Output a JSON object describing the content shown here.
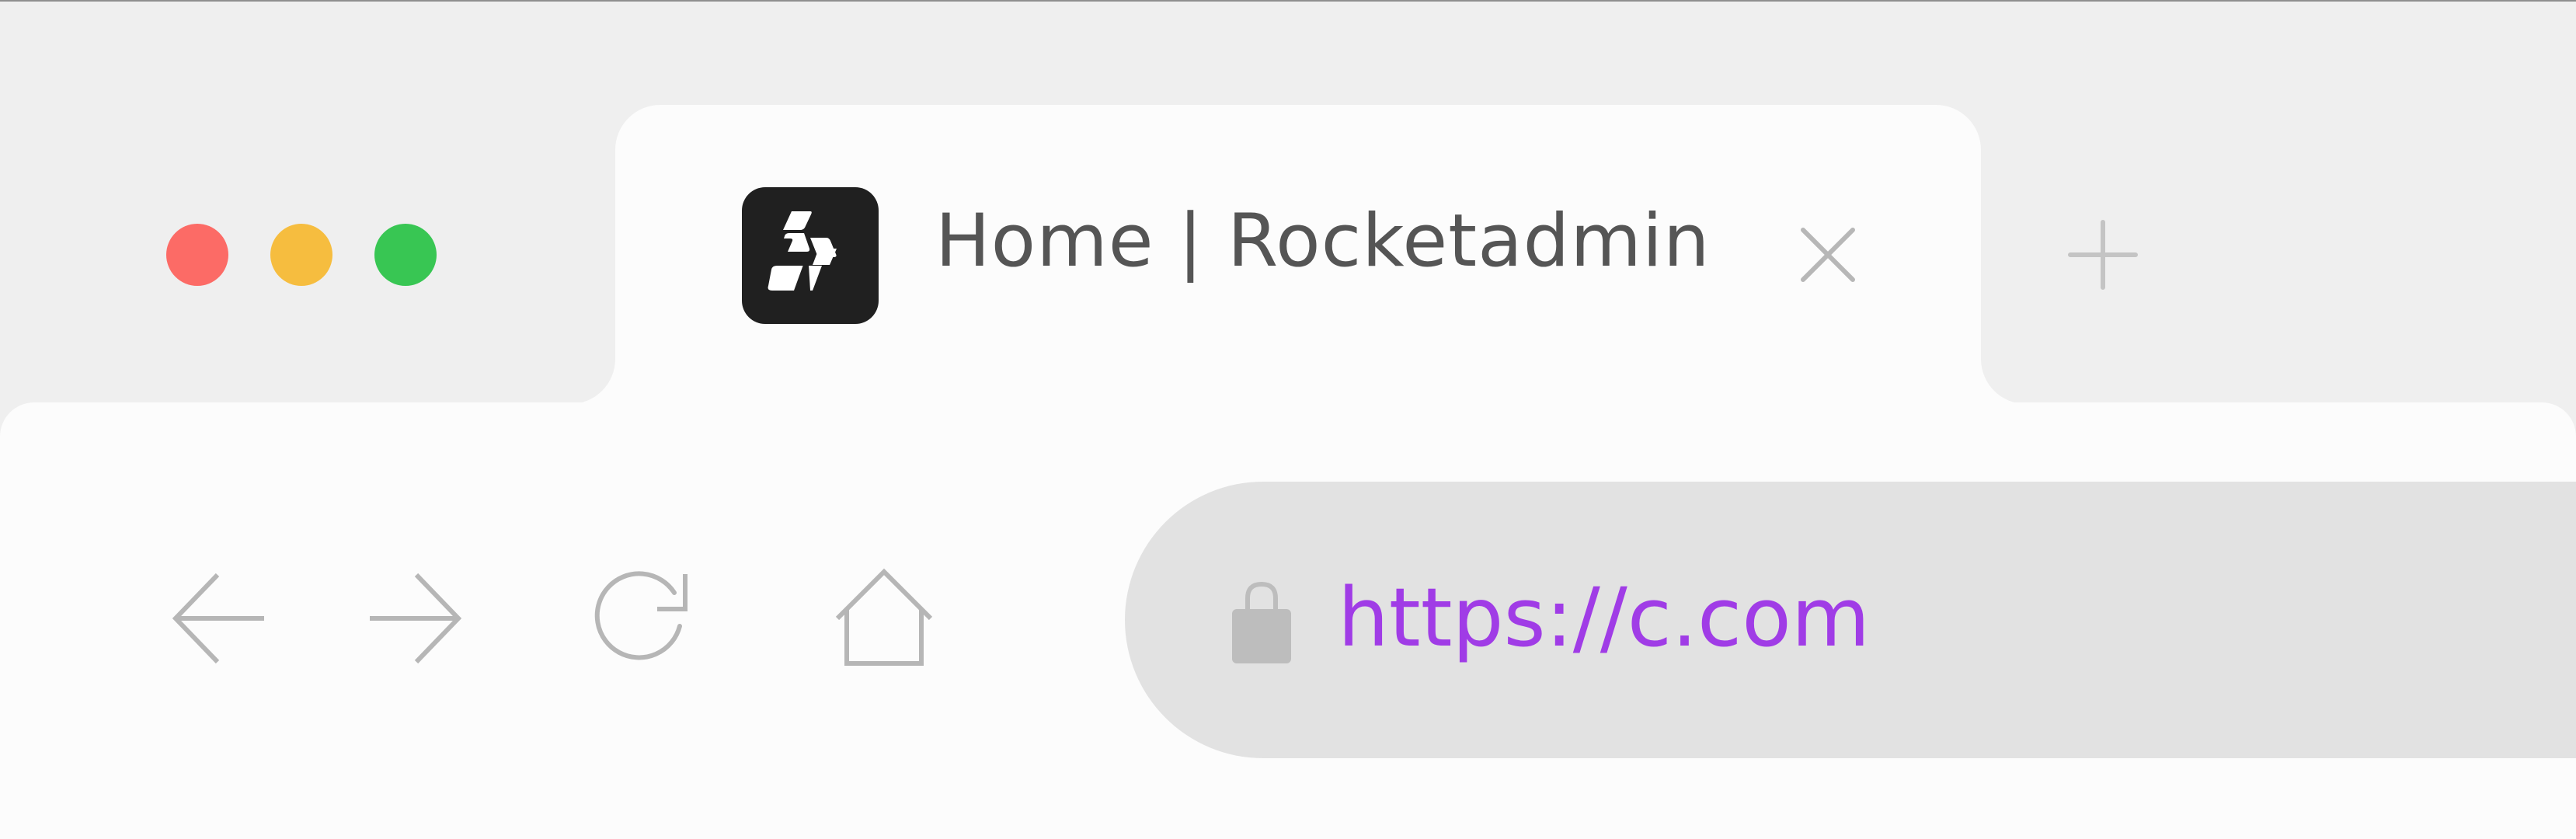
{
  "window": {
    "controls": {
      "close_color": "#fc6b66",
      "minimize_color": "#f6bd3f",
      "zoom_color": "#38c653"
    }
  },
  "tab": {
    "title": "Home | Rocketadmin",
    "logo_icon": "rocketadmin-logo-icon",
    "close_icon": "close-icon",
    "new_tab_icon": "plus-icon"
  },
  "navigation": {
    "back_icon": "arrow-left-icon",
    "forward_icon": "arrow-right-icon",
    "reload_icon": "reload-icon",
    "home_icon": "home-icon"
  },
  "address_bar": {
    "url": "https://c.com",
    "lock_icon": "lock-icon",
    "url_color": "#a03ce6"
  }
}
